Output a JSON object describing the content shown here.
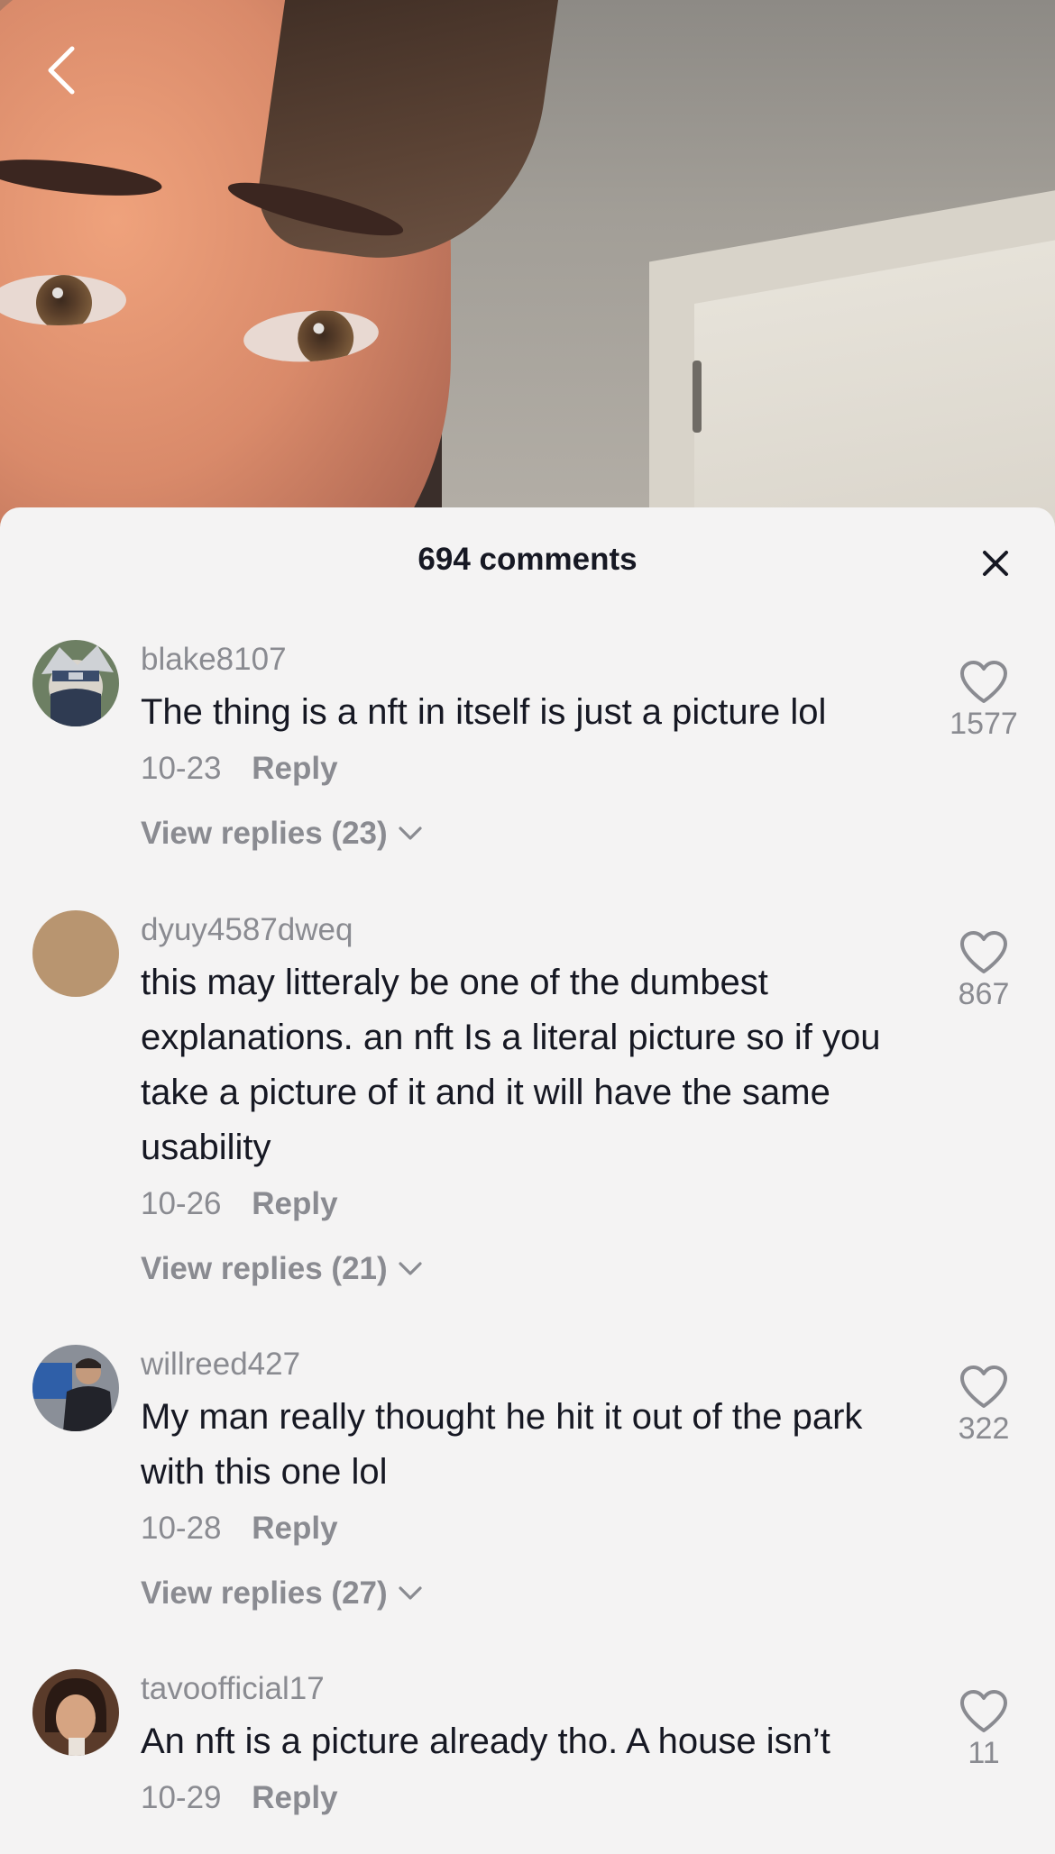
{
  "sheet": {
    "title": "694 comments"
  },
  "comments": [
    {
      "username": "blake8107",
      "text": "The thing is a nft in itself is just a picture lol",
      "date": "10-23",
      "reply_label": "Reply",
      "view_replies": "View replies (23)",
      "likes": "1577",
      "avatar_color": "#6d7f63"
    },
    {
      "username": "dyuy4587dweq",
      "text": "this may litteraly be one of the dumbest explanations. an nft Is a literal picture so if you take a picture of it and it will have the same usability",
      "date": "10-26",
      "reply_label": "Reply",
      "view_replies": "View replies (21)",
      "likes": "867",
      "avatar_color": "#b89570"
    },
    {
      "username": "willreed427",
      "text": "My man really thought he hit it out of the park with this one lol",
      "date": "10-28",
      "reply_label": "Reply",
      "view_replies": "View replies (27)",
      "likes": "322",
      "avatar_color": "#4d4f57"
    },
    {
      "username": "tavoofficial17",
      "text": "An nft is a picture already tho. A house isn’t",
      "date": "10-29",
      "reply_label": "Reply",
      "likes": "11",
      "avatar_color": "#5a3b2a"
    }
  ],
  "icons": {
    "back": "chevron-left-icon",
    "close": "close-icon",
    "like": "heart-outline-icon",
    "expand": "chevron-down-icon"
  },
  "colors": {
    "primary_text": "#161823",
    "secondary_text": "#8a8b91",
    "sheet_bg": "#f4f3f3"
  }
}
